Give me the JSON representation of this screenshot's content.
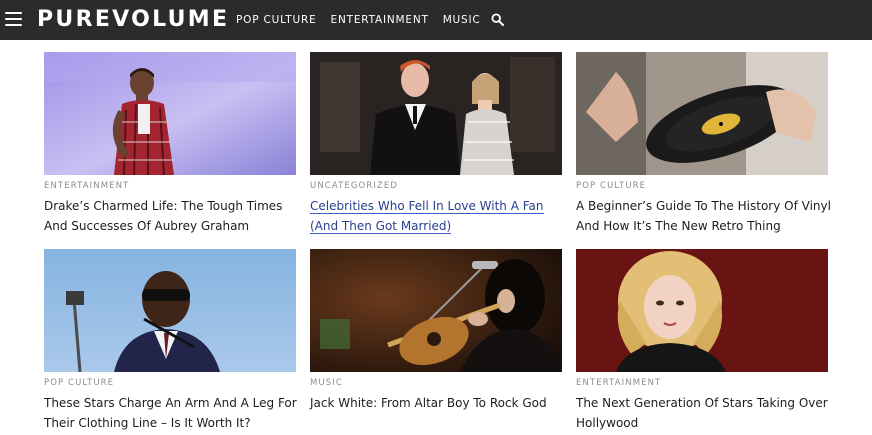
{
  "header": {
    "logo": "PUREVOLUME",
    "nav": [
      "POP CULTURE",
      "ENTERTAINMENT",
      "MUSIC"
    ]
  },
  "articles": [
    {
      "category": "ENTERTAINMENT",
      "title": "Drake’s Charmed Life: The Tough Times And Successes Of Aubrey Graham"
    },
    {
      "category": "UNCATEGORIZED",
      "title": "Celebrities Who Fell In Love With A Fan (And Then Got Married)"
    },
    {
      "category": "POP CULTURE",
      "title": "A Beginner’s Guide To The History Of Vinyl And How It’s The New Retro Thing"
    },
    {
      "category": "POP CULTURE",
      "title": "These Stars Charge An Arm And A Leg For Their Clothing Line – Is It Worth It?"
    },
    {
      "category": "MUSIC",
      "title": "Jack White: From Altar Boy To Rock God"
    },
    {
      "category": "ENTERTAINMENT",
      "title": "The Next Generation Of Stars Taking Over Hollywood"
    }
  ],
  "colors": {
    "header_bg": "#2b2b2b",
    "category_text": "#8c8c8c",
    "link_underline": "#3b5ec9"
  }
}
